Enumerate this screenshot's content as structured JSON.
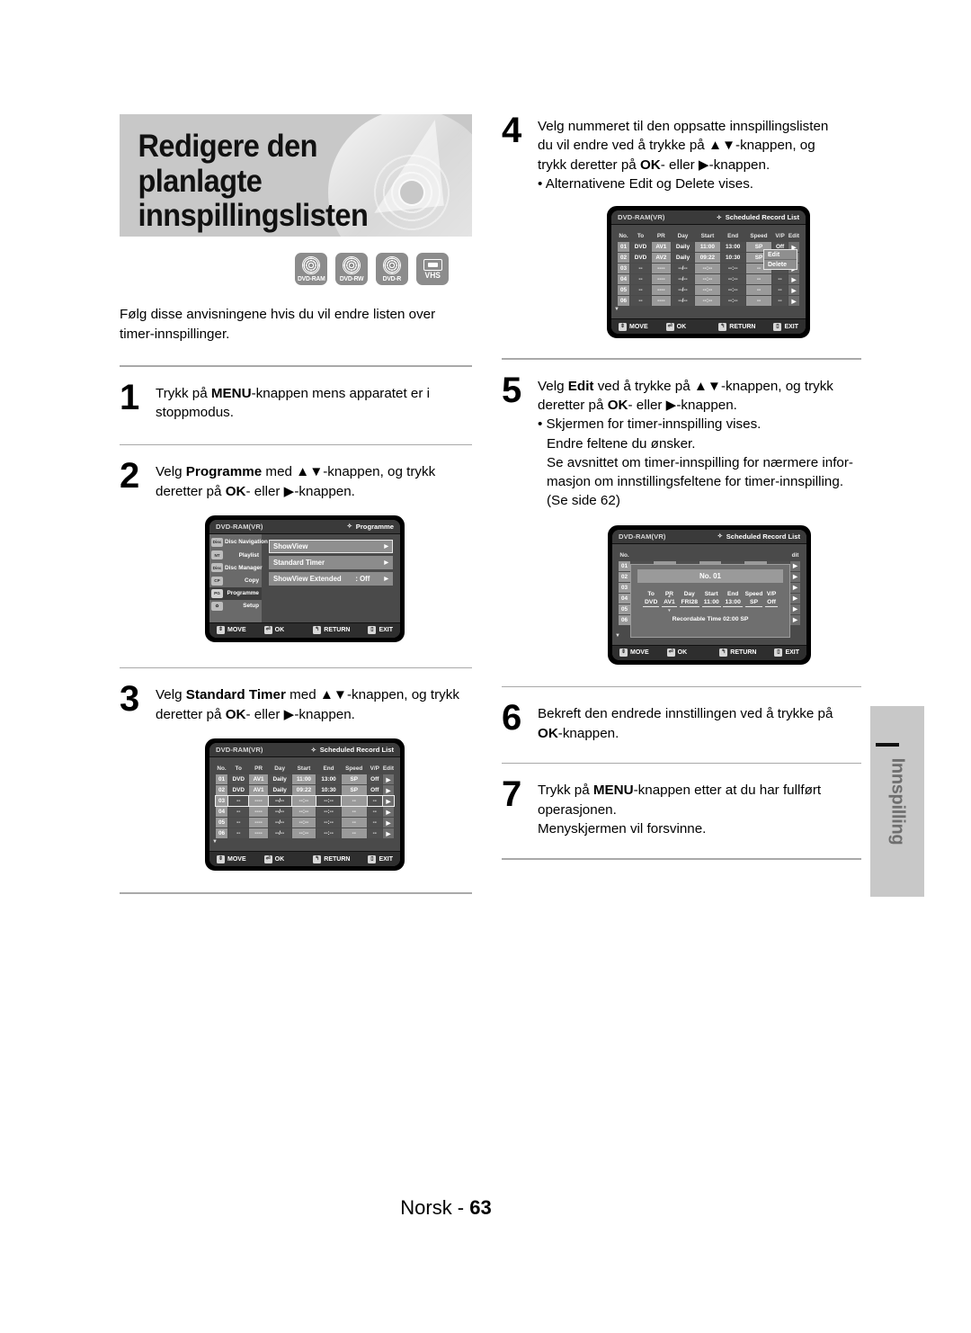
{
  "header": {
    "title_line1": "Redigere den planlagte",
    "title_line2": "innspillingslisten",
    "badges": [
      {
        "label": "DVD-RAM",
        "kind": "disc"
      },
      {
        "label": "DVD-RW",
        "kind": "disc"
      },
      {
        "label": "DVD-R",
        "kind": "disc"
      },
      {
        "label": "VHS",
        "kind": "tape"
      }
    ]
  },
  "intro": "Følg disse anvisningene hvis du vil endre listen over timer-innspillinger.",
  "steps": {
    "s1": {
      "num": "1",
      "line1_a": "Trykk på ",
      "line1_b": "MENU",
      "line1_c": "-knappen mens apparatet er i",
      "line2": "stoppmodus."
    },
    "s2": {
      "num": "2",
      "line1_a": "Velg ",
      "line1_b": "Programme",
      "line1_c": " med ▲▼-knappen, og trykk",
      "line2_a": "deretter på ",
      "line2_b": "OK",
      "line2_c": "- eller  ▶-knappen."
    },
    "s3": {
      "num": "3",
      "line1_a": "Velg ",
      "line1_b": "Standard Timer",
      "line1_c": " med ▲▼-knappen, og trykk",
      "line2_a": "deretter på ",
      "line2_b": "OK",
      "line2_c": "- eller ▶-knappen."
    },
    "s4": {
      "num": "4",
      "line1": "Velg nummeret til den oppsatte innspillingslisten",
      "line2": "du vil endre ved å trykke på ▲▼-knappen, og",
      "line3_a": "trykk deretter på ",
      "line3_b": "OK",
      "line3_c": "- eller  ▶-knappen.",
      "bullet1": "• Alternativene Edit og Delete vises."
    },
    "s5": {
      "num": "5",
      "line1_a": "Velg ",
      "line1_b": "Edit",
      "line1_c": " ved å trykke på ▲▼-knappen, og trykk",
      "line2_a": "deretter på ",
      "line2_b": "OK",
      "line2_c": "- eller  ▶-knappen.",
      "bullet1": "• Skjermen for timer-innspilling vises.",
      "bullet1_l2": "Endre feltene du ønsker.",
      "bullet1_l3": "Se avsnittet om timer-innspilling for nærmere infor-",
      "bullet1_l4": "masjon om innstillingsfeltene for timer-innspilling.",
      "bullet1_l5": "(Se side 62)"
    },
    "s6": {
      "num": "6",
      "line1": "Bekreft den endrede innstillingen ved å trykke på",
      "line2_b": "OK",
      "line2_c": "-knappen."
    },
    "s7": {
      "num": "7",
      "line1_a": "Trykk på ",
      "line1_b": "MENU",
      "line1_c": "-knappen etter at du har fullført",
      "line2": "operasjonen.",
      "line3": "Menyskjermen vil forsvinne."
    }
  },
  "osd_common": {
    "disc_type": "DVD-RAM(VR)",
    "diamond": "✧",
    "bar": [
      {
        "icon": "⇕",
        "label": "MOVE"
      },
      {
        "icon": "⏎",
        "label": "OK"
      },
      {
        "icon": "↰",
        "label": "RETURN"
      },
      {
        "icon": "▯",
        "label": "EXIT"
      }
    ]
  },
  "osd_programme": {
    "title": "Programme",
    "sidebar": [
      {
        "label": "Disc Navigation",
        "icon": "Disc",
        "selected": false
      },
      {
        "label": "Playlist",
        "icon": "NT",
        "selected": false
      },
      {
        "label": "Disc Manager",
        "icon": "Disc",
        "selected": false
      },
      {
        "label": "Copy",
        "icon": "CP",
        "selected": false
      },
      {
        "label": "Programme",
        "icon": "PG",
        "selected": true
      },
      {
        "label": "Setup",
        "icon": "✿",
        "selected": false
      }
    ],
    "items": [
      {
        "label": "ShowView",
        "value": "",
        "highlighted": true
      },
      {
        "label": "Standard Timer",
        "value": "",
        "highlighted": false
      },
      {
        "label": "ShowView Extended",
        "value": ": Off",
        "highlighted": false
      }
    ]
  },
  "osd_sched_step3": {
    "title": "Scheduled Record List",
    "columns": [
      "No.",
      "To",
      "PR",
      "Day",
      "Start",
      "End",
      "Speed",
      "V/P",
      "Edit"
    ],
    "rows": [
      {
        "no": "01",
        "to": "DVD",
        "pr": "AV1",
        "day": "Daily",
        "start": "11:00",
        "end": "13:00",
        "speed": "SP",
        "vp": "Off",
        "selected": false
      },
      {
        "no": "02",
        "to": "DVD",
        "pr": "AV1",
        "day": "Daily",
        "start": "09:22",
        "end": "10:30",
        "speed": "SP",
        "vp": "Off",
        "selected": false
      },
      {
        "no": "03",
        "to": "--",
        "pr": "----",
        "day": "--/--",
        "start": "--:--",
        "end": "--:--",
        "speed": "--",
        "vp": "--",
        "selected": true
      },
      {
        "no": "04",
        "to": "--",
        "pr": "----",
        "day": "--/--",
        "start": "--:--",
        "end": "--:--",
        "speed": "--",
        "vp": "--",
        "selected": false
      },
      {
        "no": "05",
        "to": "--",
        "pr": "----",
        "day": "--/--",
        "start": "--:--",
        "end": "--:--",
        "speed": "--",
        "vp": "--",
        "selected": false
      },
      {
        "no": "06",
        "to": "--",
        "pr": "----",
        "day": "--/--",
        "start": "--:--",
        "end": "--:--",
        "speed": "--",
        "vp": "--",
        "selected": false
      }
    ]
  },
  "osd_sched_step4": {
    "title": "Scheduled Record List",
    "columns": [
      "No.",
      "To",
      "PR",
      "Day",
      "Start",
      "End",
      "Speed",
      "V/P",
      "Edit"
    ],
    "rows": [
      {
        "no": "01",
        "to": "DVD",
        "pr": "AV1",
        "day": "Daily",
        "start": "11:00",
        "end": "13:00",
        "speed": "SP",
        "vp": "Off",
        "selected": false
      },
      {
        "no": "02",
        "to": "DVD",
        "pr": "AV2",
        "day": "Daily",
        "start": "09:22",
        "end": "10:30",
        "speed": "SP",
        "vp": "Off",
        "selected": false
      },
      {
        "no": "03",
        "to": "--",
        "pr": "----",
        "day": "--/--",
        "start": "--:--",
        "end": "--:--",
        "speed": "--",
        "vp": "--",
        "selected": false
      },
      {
        "no": "04",
        "to": "--",
        "pr": "----",
        "day": "--/--",
        "start": "--:--",
        "end": "--:--",
        "speed": "--",
        "vp": "--",
        "selected": false
      },
      {
        "no": "05",
        "to": "--",
        "pr": "----",
        "day": "--/--",
        "start": "--:--",
        "end": "--:--",
        "speed": "--",
        "vp": "--",
        "selected": false
      },
      {
        "no": "06",
        "to": "--",
        "pr": "----",
        "day": "--/--",
        "start": "--:--",
        "end": "--:--",
        "speed": "--",
        "vp": "--",
        "selected": false
      }
    ],
    "popup": [
      "Edit",
      "Delete"
    ]
  },
  "osd_timer_edit": {
    "title": "Scheduled Record List",
    "dialog_title": "No. 01",
    "fields": [
      {
        "label": "To",
        "value": "DVD",
        "active": false
      },
      {
        "label": "PR",
        "value": "AV1",
        "active": true
      },
      {
        "label": "Day",
        "value": "FRI28",
        "active": false
      },
      {
        "label": "Start",
        "value": "11:00",
        "active": false
      },
      {
        "label": "End",
        "value": "13:00",
        "active": false
      },
      {
        "label": "Speed",
        "value": "SP",
        "active": false
      },
      {
        "label": "V/P",
        "value": "Off",
        "active": false
      }
    ],
    "footer": "Recordable Time 02:00 SP",
    "row_numbers": [
      "No.",
      "01",
      "02",
      "03",
      "04",
      "05",
      "06"
    ],
    "edit_col_label": "dit"
  },
  "side_tab": {
    "label": "Innspilling"
  },
  "footer": {
    "lang": "Norsk - ",
    "page": "63"
  }
}
